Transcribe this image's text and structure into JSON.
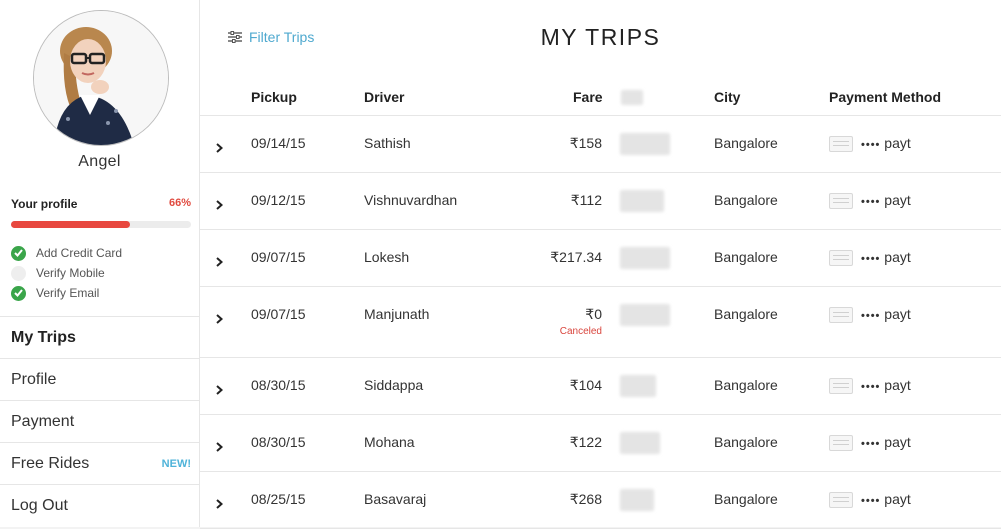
{
  "user": {
    "name": "Angel"
  },
  "profile": {
    "label": "Your profile",
    "percent_text": "66%",
    "progress": 0.66,
    "checklist": [
      {
        "label": "Add Credit Card",
        "done": true
      },
      {
        "label": "Verify Mobile",
        "done": false
      },
      {
        "label": "Verify Email",
        "done": true
      }
    ]
  },
  "nav": {
    "items": [
      {
        "label": "My Trips",
        "active": true,
        "badge": ""
      },
      {
        "label": "Profile",
        "active": false,
        "badge": ""
      },
      {
        "label": "Payment",
        "active": false,
        "badge": ""
      },
      {
        "label": "Free Rides",
        "active": false,
        "badge": "NEW!"
      },
      {
        "label": "Log Out",
        "active": false,
        "badge": ""
      }
    ]
  },
  "main": {
    "title": "MY TRIPS",
    "filter_label": "Filter Trips",
    "columns": {
      "pickup": "Pickup",
      "driver": "Driver",
      "fare": "Fare",
      "city": "City",
      "payment": "Payment Method"
    }
  },
  "trips": [
    {
      "pickup": "09/14/15",
      "driver": "Sathish",
      "fare": "₹158",
      "status": "",
      "city": "Bangalore",
      "payment": "payt"
    },
    {
      "pickup": "09/12/15",
      "driver": "Vishnuvardhan",
      "fare": "₹112",
      "status": "",
      "city": "Bangalore",
      "payment": "payt"
    },
    {
      "pickup": "09/07/15",
      "driver": "Lokesh",
      "fare": "₹217.34",
      "status": "",
      "city": "Bangalore",
      "payment": "payt"
    },
    {
      "pickup": "09/07/15",
      "driver": "Manjunath",
      "fare": "₹0",
      "status": "Canceled",
      "city": "Bangalore",
      "payment": "payt"
    },
    {
      "pickup": "08/30/15",
      "driver": "Siddappa",
      "fare": "₹104",
      "status": "",
      "city": "Bangalore",
      "payment": "payt"
    },
    {
      "pickup": "08/30/15",
      "driver": "Mohana",
      "fare": "₹122",
      "status": "",
      "city": "Bangalore",
      "payment": "payt"
    },
    {
      "pickup": "08/25/15",
      "driver": "Basavaraj",
      "fare": "₹268",
      "status": "",
      "city": "Bangalore",
      "payment": "payt"
    }
  ],
  "colors": {
    "accent_blue": "#4fa9cf",
    "progress_red": "#e8483f",
    "check_green": "#3aa54a",
    "canceled_red": "#d9453d"
  }
}
